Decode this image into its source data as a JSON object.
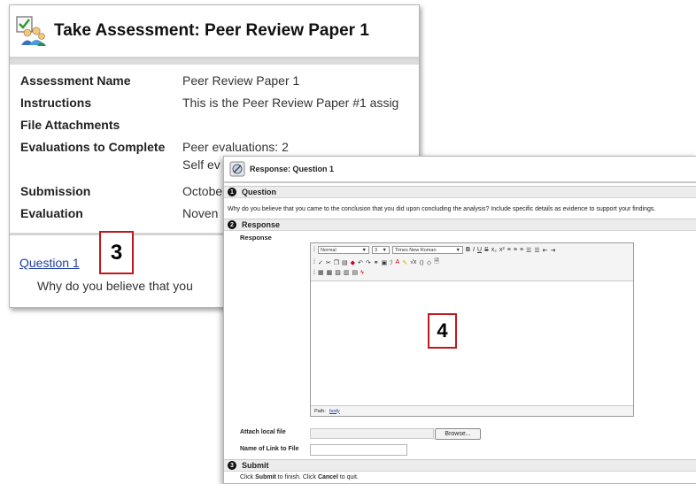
{
  "assessment_window": {
    "title": "Take Assessment: Peer Review Paper 1",
    "icon": "assessment-people-icon",
    "rows": [
      {
        "label": "Assessment Name",
        "value": "Peer Review Paper 1"
      },
      {
        "label": "Instructions",
        "value": "This is the Peer Review Paper #1 assig"
      },
      {
        "label": "File Attachments",
        "value": ""
      },
      {
        "label": "Evaluations to Complete",
        "value": "Peer evaluations: 2",
        "value2": "Self ev"
      },
      {
        "label": "Submission",
        "value": "Octobe"
      },
      {
        "label": "Evaluation",
        "value": "Noven"
      }
    ],
    "question_link": "Question 1",
    "question_text": "Why do you believe that you"
  },
  "callouts": {
    "a": "3",
    "b": "4"
  },
  "response_window": {
    "title": "Response: Question 1",
    "sections": [
      {
        "num": "1",
        "label": "Question"
      },
      {
        "num": "2",
        "label": "Response"
      },
      {
        "num": "3",
        "label": "Submit"
      }
    ],
    "question_text": "Why do you believe that you came to the conclusion that you did upon concluding the analysis? Include specific details as evidence to support your findings.",
    "response_label": "Response",
    "editor": {
      "format_select": "Normal",
      "size_select": "3",
      "font_select": "Times New Roman",
      "path_label": "Path:",
      "path_value": "body"
    },
    "attach_label": "Attach local file",
    "browse_label": "Browse...",
    "link_name_label": "Name of Link to File",
    "submit_instruction": {
      "part1": "Click ",
      "submit": "Submit",
      "part2": " to finish. Click ",
      "cancel": "Cancel",
      "part3": " to quit."
    }
  },
  "colors": {
    "callout_border": "#c0191b",
    "link": "#1f3f9e",
    "section_bg": "#ececec"
  }
}
